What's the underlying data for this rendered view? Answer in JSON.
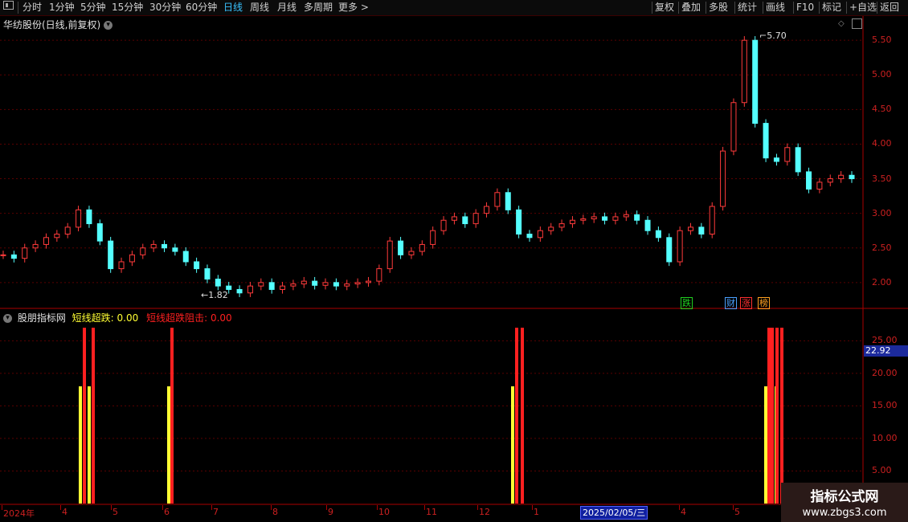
{
  "toolbar": {
    "left_items": [
      "分时",
      "1分钟",
      "5分钟",
      "15分钟",
      "30分钟",
      "60分钟",
      "日线",
      "周线",
      "月线",
      "多周期",
      "更多 >"
    ],
    "active_item": "日线",
    "right_items": [
      "复权",
      "叠加",
      "多股",
      "统计",
      "画线",
      "F10",
      "标记",
      "+自选",
      "返回"
    ]
  },
  "stock_title": "华纺股份(日线,前复权)",
  "price_axis": [
    "5.50",
    "5.00",
    "4.50",
    "4.00",
    "3.50",
    "3.00",
    "2.50",
    "2.00"
  ],
  "high_marker": "5.70",
  "low_marker": "1.82",
  "news_tags": [
    {
      "text": "跌",
      "color": "#20d020"
    },
    {
      "text": "财",
      "color": "#4aa0ff"
    },
    {
      "text": "涨",
      "color": "#ff3030"
    },
    {
      "text": "榜",
      "color": "#ffa020"
    }
  ],
  "indicator": {
    "name": "股朋指标网",
    "line1_label": "短线超跌:",
    "line1_value": "0.00",
    "line1_color": "#ffff33",
    "line2_label": "短线超跌阻击:",
    "line2_value": "0.00",
    "line2_color": "#ff2020",
    "axis": [
      "25.00",
      "20.00",
      "15.00",
      "10.00",
      "5.00"
    ],
    "current_value": "22.92"
  },
  "date_axis": [
    "2024年",
    "4",
    "5",
    "6",
    "7",
    "8",
    "9",
    "10",
    "11",
    "12",
    "1",
    "4",
    "5"
  ],
  "cursor_date": "2025/02/05/三",
  "watermark": {
    "title": "指标公式网",
    "url": "www.zbgs3.com"
  },
  "chart_data": {
    "type": "candlestick",
    "title": "华纺股份(日线,前复权)",
    "ylim": [
      1.65,
      5.85
    ],
    "high": 5.7,
    "low": 1.82,
    "closes": [
      2.4,
      2.35,
      2.5,
      2.55,
      2.65,
      2.7,
      2.8,
      3.05,
      2.85,
      2.6,
      2.2,
      2.3,
      2.4,
      2.5,
      2.55,
      2.5,
      2.45,
      2.3,
      2.2,
      2.05,
      1.95,
      1.9,
      1.85,
      1.95,
      2.0,
      1.9,
      1.95,
      1.98,
      2.02,
      1.96,
      2.0,
      1.95,
      1.98,
      2.0,
      2.02,
      2.2,
      2.6,
      2.4,
      2.45,
      2.55,
      2.75,
      2.9,
      2.95,
      2.85,
      3.0,
      3.1,
      3.3,
      3.05,
      2.7,
      2.65,
      2.75,
      2.8,
      2.85,
      2.9,
      2.92,
      2.95,
      2.9,
      2.95,
      2.98,
      2.9,
      2.75,
      2.65,
      2.3,
      2.75,
      2.8,
      2.7,
      3.1,
      3.9,
      4.6,
      5.5,
      4.3,
      3.8,
      3.75,
      3.95,
      3.6,
      3.35,
      3.45,
      3.5,
      3.55,
      3.5
    ],
    "indicator_series": [
      {
        "name": "短线超跌",
        "color": "#ffff33",
        "bars": [
          [
            100,
            18
          ],
          [
            111,
            18
          ],
          [
            210,
            18
          ],
          [
            638,
            18
          ],
          [
            650,
            18
          ],
          [
            953,
            18
          ],
          [
            966,
            18
          ]
        ]
      },
      {
        "name": "短线超跌阻击",
        "color": "#ff2020",
        "bars": [
          [
            105,
            27
          ],
          [
            116,
            27
          ],
          [
            214,
            27
          ],
          [
            643,
            27
          ],
          [
            650,
            27
          ],
          [
            957,
            27
          ],
          [
            961,
            27
          ],
          [
            967,
            27
          ],
          [
            973,
            27
          ]
        ]
      }
    ],
    "indicator_ylim": [
      0,
      28
    ]
  }
}
